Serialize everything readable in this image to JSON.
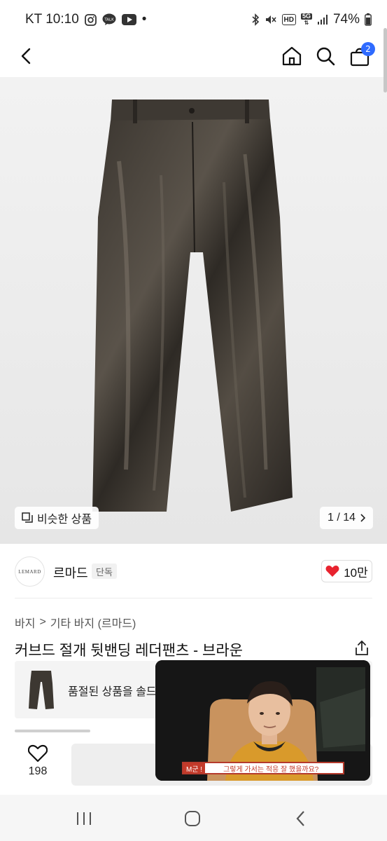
{
  "status_bar": {
    "carrier_time": "KT 10:10",
    "app_icons": [
      "instagram-icon",
      "kakaotalk-icon",
      "youtube-icon"
    ],
    "dot": "•",
    "hd": "HD",
    "network": "5G",
    "battery": "74%"
  },
  "header": {
    "icons": [
      "back-arrow-icon",
      "home-icon",
      "search-icon",
      "shopping-bag-icon"
    ],
    "cart_count": "2"
  },
  "image": {
    "similar_label": "비슷한 상품",
    "page": "1 / 14"
  },
  "seller": {
    "logo_text": "LEMARD",
    "name": "르마드",
    "badge": "단독",
    "likes": "10만"
  },
  "breadcrumb": {
    "level1": "바지",
    "separator": ">",
    "level2": "기타 바지 (르마드)"
  },
  "product": {
    "title": "커브드 절개 뒷밴딩 레더팬츠 - 브라운",
    "soldout_text": "품절된 상품을 솔드"
  },
  "bottom_bar": {
    "wish_count": "198"
  },
  "video": {
    "speaker": "M군 !",
    "subtitle": "그렇게 가서는 적응 잘 했을까요?"
  },
  "colors": {
    "accent_blue": "#2f6bff",
    "heart_red": "#e8232f",
    "subtitle_red": "#c33a2a"
  }
}
